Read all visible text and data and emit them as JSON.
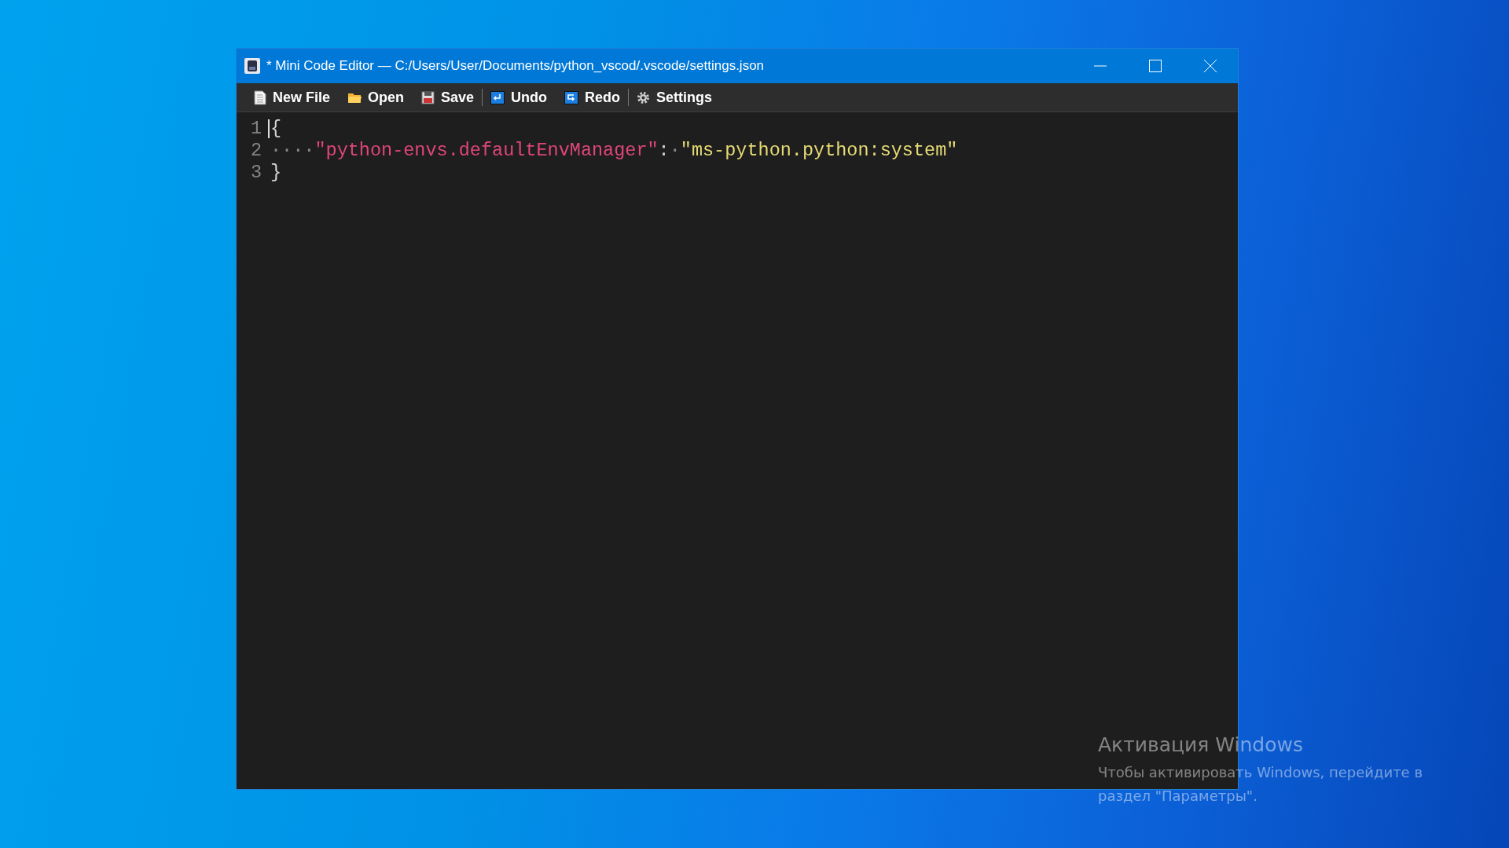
{
  "window": {
    "title": "* Mini Code Editor — C:/Users/User/Documents/python_vscod/.vscode/settings.json"
  },
  "toolbar": {
    "groups": [
      {
        "items": [
          {
            "kind": "new",
            "label": "New File"
          },
          {
            "kind": "open",
            "label": "Open"
          },
          {
            "kind": "save",
            "label": "Save"
          }
        ]
      },
      {
        "items": [
          {
            "kind": "undo",
            "label": "Undo"
          },
          {
            "kind": "redo",
            "label": "Redo"
          }
        ]
      },
      {
        "items": [
          {
            "kind": "settings",
            "label": "Settings"
          }
        ]
      }
    ]
  },
  "editor": {
    "lines": [
      {
        "number": "1",
        "tokens": [
          {
            "kind": "punct",
            "text": "{"
          }
        ]
      },
      {
        "number": "2",
        "tokens": [
          {
            "kind": "space",
            "text": "····"
          },
          {
            "kind": "key",
            "text": "\"python-envs.defaultEnvManager\""
          },
          {
            "kind": "punct",
            "text": ":"
          },
          {
            "kind": "space",
            "text": "·"
          },
          {
            "kind": "string",
            "text": "\"ms-python.python:system\""
          }
        ]
      },
      {
        "number": "3",
        "tokens": [
          {
            "kind": "punct",
            "text": "}"
          }
        ]
      }
    ]
  },
  "activation": {
    "title": "Активация Windows",
    "lines": [
      "Чтобы активировать Windows, перейдите в",
      "раздел \"Параметры\"."
    ]
  }
}
